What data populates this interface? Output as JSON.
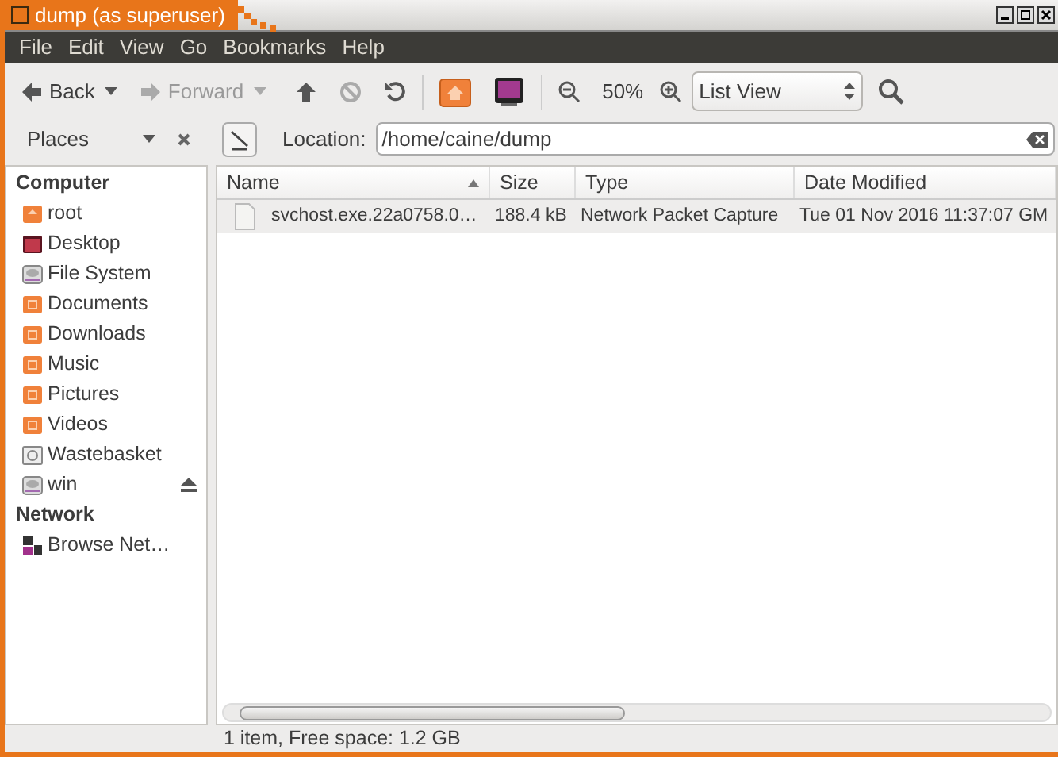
{
  "window": {
    "title": "dump (as superuser)"
  },
  "menu": [
    "File",
    "Edit",
    "View",
    "Go",
    "Bookmarks",
    "Help"
  ],
  "toolbar": {
    "back": {
      "label": "Back",
      "disabled": false
    },
    "forward": {
      "label": "Forward",
      "disabled": true
    },
    "stop_disabled": true,
    "zoom": "50%",
    "view": "List View"
  },
  "sidebar": {
    "title": "Places",
    "location_label": "Location:",
    "location": "/home/caine/dump",
    "sections": [
      {
        "heading": "Computer",
        "items": [
          {
            "label": "root",
            "kind": "home"
          },
          {
            "label": "Desktop",
            "kind": "desktop"
          },
          {
            "label": "File System",
            "kind": "drive"
          },
          {
            "label": "Documents",
            "kind": "folder"
          },
          {
            "label": "Downloads",
            "kind": "folder"
          },
          {
            "label": "Music",
            "kind": "folder"
          },
          {
            "label": "Pictures",
            "kind": "folder"
          },
          {
            "label": "Videos",
            "kind": "folder"
          },
          {
            "label": "Wastebasket",
            "kind": "trash"
          },
          {
            "label": "win",
            "kind": "drive",
            "ejectable": true
          }
        ]
      },
      {
        "heading": "Network",
        "items": [
          {
            "label": "Browse Net…",
            "kind": "network"
          }
        ]
      }
    ]
  },
  "table": {
    "columns": [
      {
        "label": "Name",
        "sorted": true
      },
      {
        "label": "Size",
        "sorted": false
      },
      {
        "label": "Type",
        "sorted": false
      },
      {
        "label": "Date Modified",
        "sorted": false
      }
    ],
    "rows": [
      {
        "cells": [
          "svchost.exe.22a0758.0…",
          "188.4 kB",
          "Network Packet Capture",
          "Tue 01 Nov 2016 11:37:07 GM"
        ],
        "selected": true
      }
    ]
  },
  "status_bar": "1 item, Free space: 1.2 GB"
}
